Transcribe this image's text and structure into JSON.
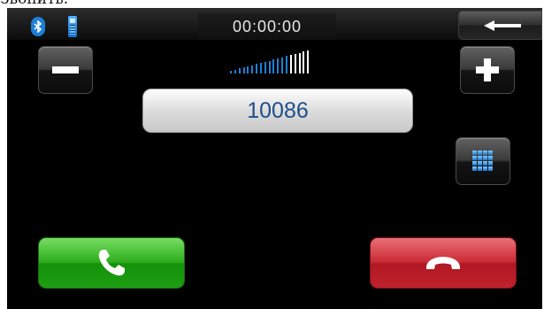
{
  "caption": {
    "text": "Звонить."
  },
  "statusbar": {
    "bluetooth_icon": "bluetooth-icon",
    "phone_icon": "mobile-phone-icon",
    "timer": "00:00:00",
    "back_icon": "back-arrow-icon"
  },
  "call": {
    "number": "10086",
    "volume_level": 0.72,
    "volume_bars": 19
  },
  "buttons": {
    "volume_down_icon": "minus-icon",
    "volume_up_icon": "plus-icon",
    "keypad_icon": "keypad-grid-icon",
    "answer_icon": "phone-handset-icon",
    "hangup_icon": "hangup-handset-icon"
  },
  "colors": {
    "screen_bg": "#000000",
    "accent_blue": "#1e7fd6",
    "number_text": "#1f4e8a",
    "call_green": "#2fae1e",
    "hangup_red": "#c92a33"
  }
}
